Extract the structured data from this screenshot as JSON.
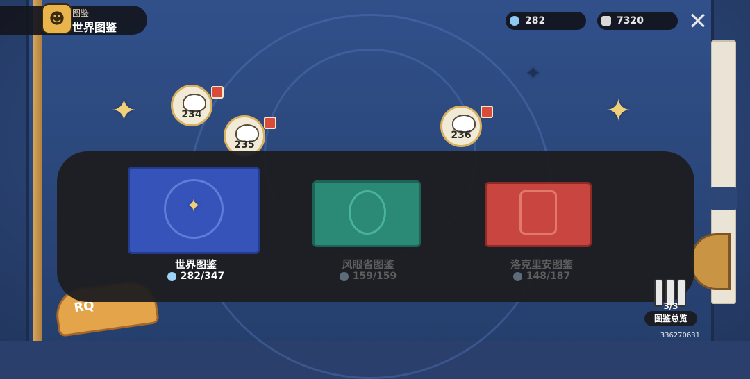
{
  "header": {
    "section_label": "图鉴",
    "title": "世界图鉴"
  },
  "currencies": [
    {
      "name": "star-currency",
      "value": "282",
      "color": "#8fc8f0"
    },
    {
      "name": "ticket-currency",
      "value": "7320",
      "color": "#d8d8d8"
    }
  ],
  "map_tokens": [
    {
      "number": "234",
      "gift": true
    },
    {
      "number": "235",
      "gift": true
    },
    {
      "number": "236",
      "gift": true
    }
  ],
  "albums": [
    {
      "label": "世界图鉴",
      "count": "282/347",
      "color": "#3553b8",
      "active": true
    },
    {
      "label": "风眼省图鉴",
      "count": "159/159",
      "color": "#2a8a76",
      "active": false
    },
    {
      "label": "洛克里安图鉴",
      "count": "148/187",
      "color": "#c8463f",
      "active": false
    }
  ],
  "overview": {
    "count": "3/3",
    "label": "图鉴总览"
  },
  "bottom_left_badge": "RQ",
  "uid": "336270631"
}
